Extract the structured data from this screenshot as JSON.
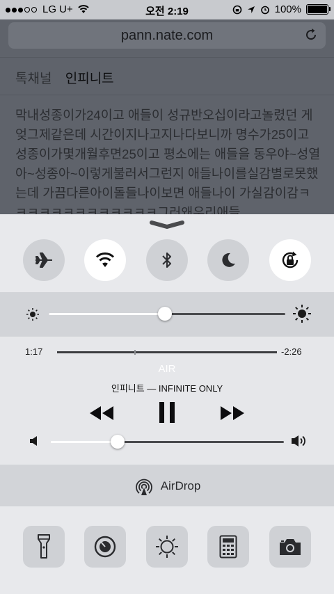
{
  "status_bar": {
    "carrier": "LG U+",
    "time": "오전 2:19",
    "battery": "100%"
  },
  "browser": {
    "url": "pann.nate.com",
    "tabs": [
      "톡채널",
      "인피니트"
    ],
    "article_text": "막내성종이가24이고 애들이 성규반오십이라고놀렸던 게 엊그제같은데 시간이지나고지나다보니까 명수가25이고 성종이가몇개월후면25이고 평소에는 애들을 동우야~성열아~성종아~이렇게불러서그런지 애들나이를실감별로못했는데 가끔다른아이돌들나이보면 애들나이 가실감이감ㅋㅋㅋㅋㅋㅋㅋㅋㅋㅋㅋㅋㅋ그러왜우리애들"
  },
  "control_center": {
    "toggles": [
      {
        "name": "airplane-mode",
        "on": false
      },
      {
        "name": "wifi",
        "on": true
      },
      {
        "name": "bluetooth",
        "on": false
      },
      {
        "name": "do-not-disturb",
        "on": false
      },
      {
        "name": "rotation-lock",
        "on": true
      }
    ],
    "brightness_level": 0.49,
    "music": {
      "elapsed": "1:17",
      "remaining": "-2:26",
      "progress": 0.35,
      "airplay_device": "AIR",
      "now_playing": "인피니트 — INFINITE ONLY",
      "volume_level": 0.29
    },
    "airdrop_label": "AirDrop",
    "shortcuts": [
      "flashlight-icon",
      "timer-icon",
      "night-shift-icon",
      "calculator-icon",
      "camera-icon"
    ],
    "colors": {
      "panel": "#e8e9ec",
      "band": "#d2d4d8",
      "toggle_off": "#cfd1d5",
      "toggle_on": "#ffffff"
    }
  }
}
